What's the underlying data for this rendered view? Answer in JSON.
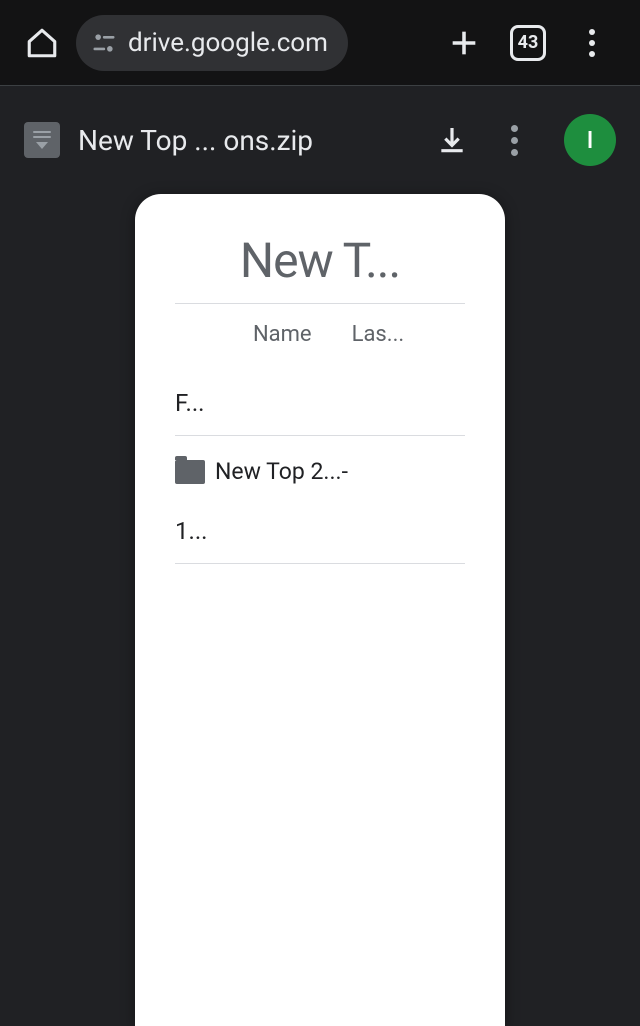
{
  "browser": {
    "url": "drive.google.com",
    "tab_count": "43"
  },
  "drive_header": {
    "file_title": "New Top ... ons.zip",
    "avatar_letter": "I",
    "avatar_color": "#1e8e3e"
  },
  "preview": {
    "title": "New T...",
    "columns": {
      "name": "Name",
      "last": "Las..."
    },
    "section_label": "F...",
    "item": {
      "name": "New Top 2...-"
    },
    "count_label": "1..."
  }
}
